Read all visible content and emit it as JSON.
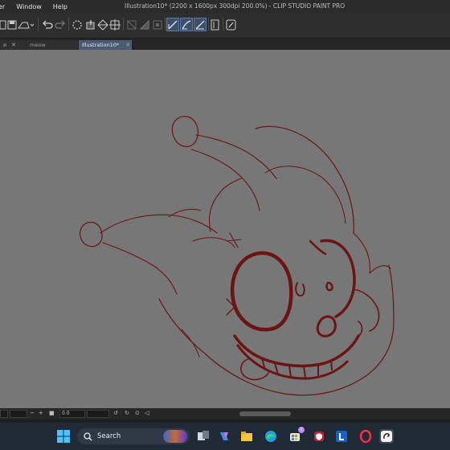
{
  "menu": {
    "items": [
      "er",
      "Window",
      "Help"
    ]
  },
  "window": {
    "title": "Illustration10* (2200 x 1600px 300dpi 200.0%) - CLIP STUDIO PAINT PRO"
  },
  "tabs": [
    {
      "label": "ø",
      "active": false
    },
    {
      "label": "meow",
      "active": false
    },
    {
      "label": "Illustration10*",
      "active": true
    }
  ],
  "status": {
    "zoom_value": "0.0"
  },
  "taskbar": {
    "search_placeholder": "Search",
    "notification_count": "1"
  },
  "colors": {
    "canvas_bg": "#777777",
    "sketch_stroke": "#6b1414",
    "accent": "#5b79a6",
    "taskbar_bg": "#202a36"
  },
  "icons": {
    "toolbar": [
      "new-file-icon",
      "save-icon",
      "print-icon",
      "undo-icon",
      "redo-icon",
      "loading-icon",
      "fill-icon",
      "transform-icon",
      "crop-icon",
      "snap-grid-icon",
      "snap-ruler-icon",
      "snap-perspective-icon",
      "stabilize-1-icon",
      "stabilize-2-icon",
      "stabilize-3-icon",
      "pen-tablet-icon",
      "help-icon"
    ],
    "taskbar": [
      "windows-start-icon",
      "search-icon",
      "task-view-icon",
      "copilot-icon",
      "file-explorer-icon",
      "edge-icon",
      "store-icon",
      "security-icon",
      "app-l-icon",
      "opera-icon",
      "clip-studio-icon"
    ]
  }
}
